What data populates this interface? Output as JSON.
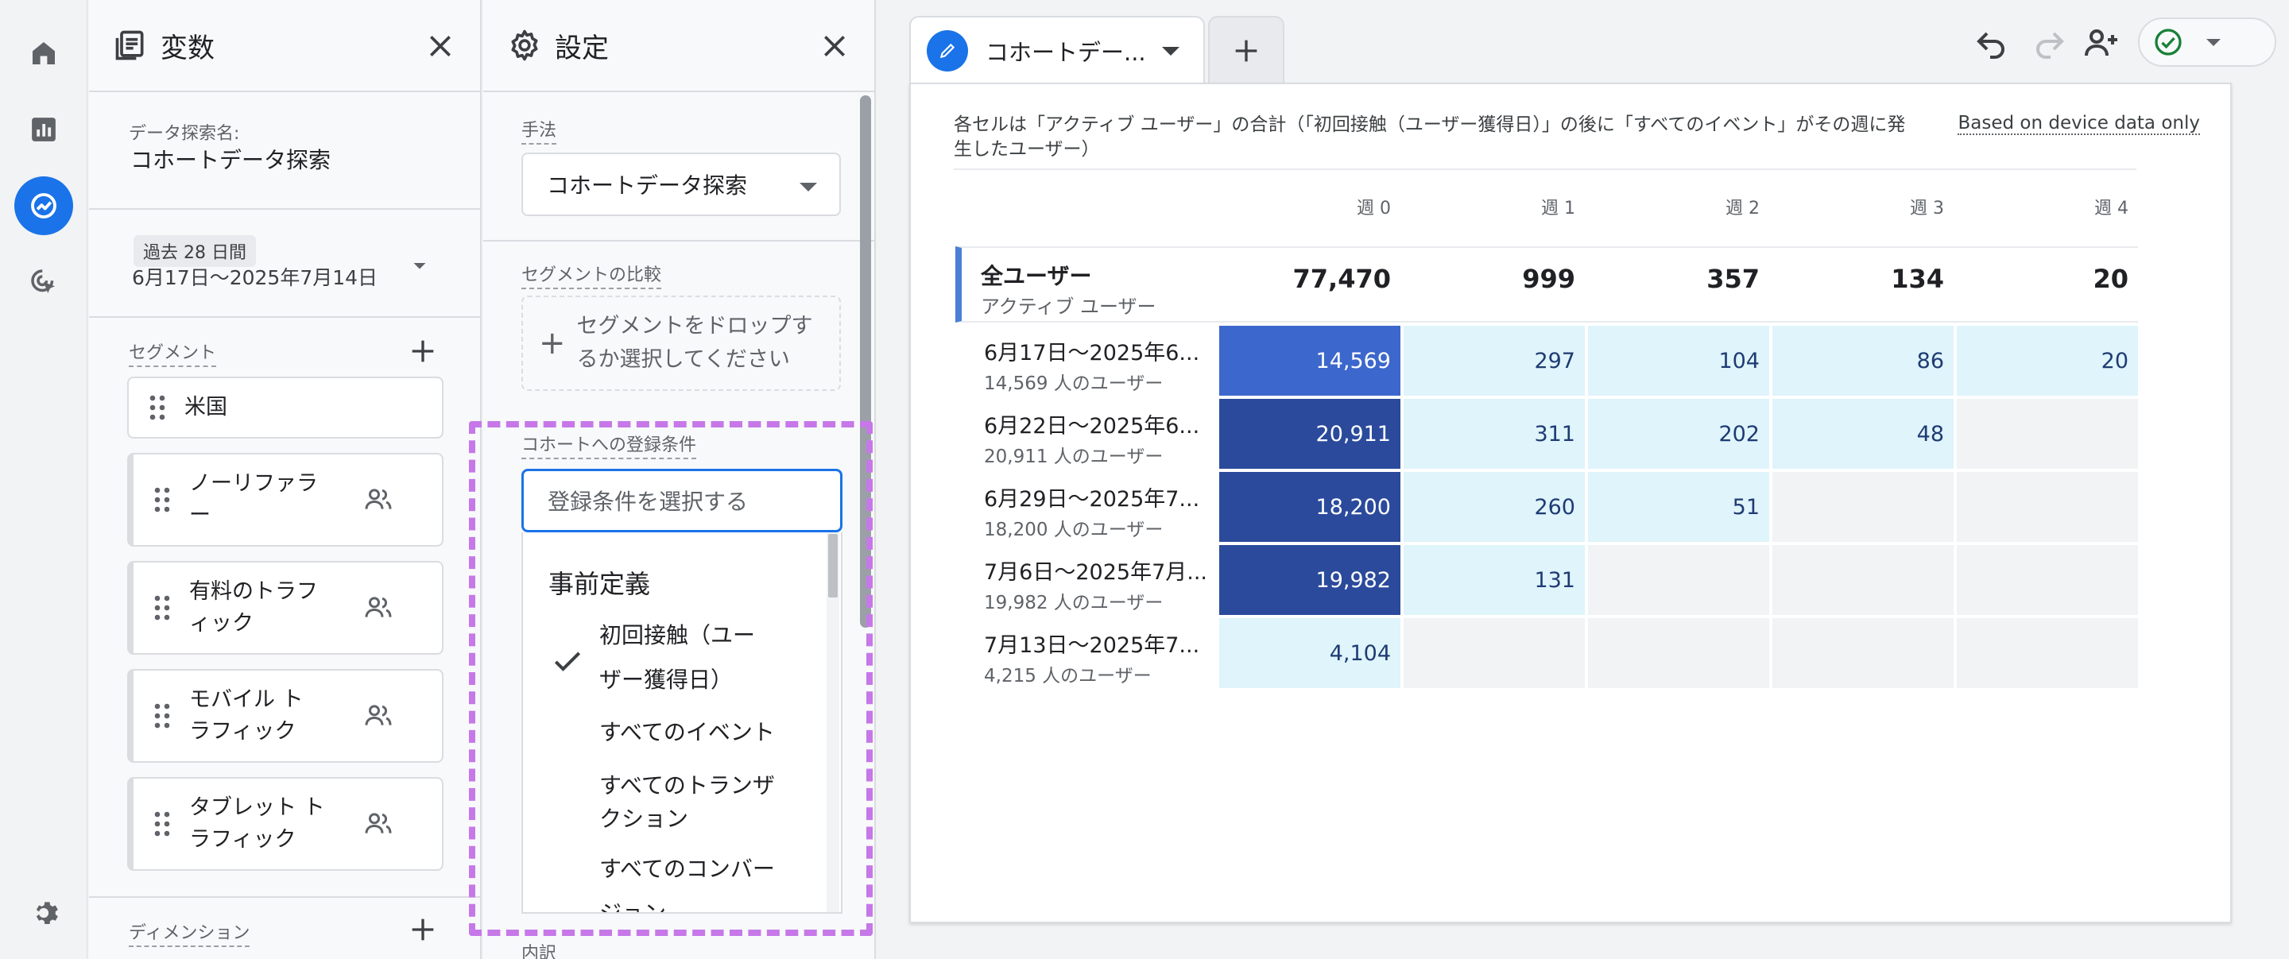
{
  "vars_panel": {
    "title": "変数",
    "explore_name_label": "データ探索名:",
    "explore_name": "コホートデータ探索",
    "date_chip": "過去 28 日間",
    "date_range": "6月17日～2025年7月14日",
    "segments_label": "セグメント",
    "segments": [
      {
        "lines": [
          "米国"
        ],
        "has_icon": false
      },
      {
        "lines": [
          "ノーリファラ",
          "ー"
        ],
        "has_icon": true
      },
      {
        "lines": [
          "有料のトラフ",
          "ィック"
        ],
        "has_icon": true
      },
      {
        "lines": [
          "モバイル ト",
          "ラフィック"
        ],
        "has_icon": true
      },
      {
        "lines": [
          "タブレット ト",
          "ラフィック"
        ],
        "has_icon": true
      }
    ],
    "dimensions_label": "ディメンション"
  },
  "settings_panel": {
    "title": "設定",
    "method_label": "手法",
    "method_value": "コホートデータ探索",
    "segment_compare_label": "セグメントの比較",
    "drop_zone_line1": "セグメントをドロップす",
    "drop_zone_line2": "るか選択してください",
    "cohort_condition_label": "コホートへの登録条件",
    "cohort_condition_placeholder": "登録条件を選択する",
    "dropdown_group": "事前定義",
    "dropdown_options": [
      {
        "line1": "初回接触（ユー",
        "line2": "ザー獲得日）",
        "selected": true
      },
      {
        "line1": "すべてのイベント",
        "line2": "",
        "selected": false
      },
      {
        "line1": "すべてのトランザ",
        "line2": "クション",
        "selected": false
      },
      {
        "line1": "すべてのコンバー",
        "line2": "ジョン",
        "selected": false
      }
    ],
    "breakdown_label": "内訳"
  },
  "tab": {
    "label": "コホートデー..."
  },
  "report": {
    "description": "各セルは「アクティブ ユーザー」の合計（「初回接触（ユーザー獲得日）」の後に「すべてのイベント」がその週に発生したユーザー）",
    "device_link": "Based on device data only",
    "week_headers": [
      "週 0",
      "週 1",
      "週 2",
      "週 3",
      "週 4"
    ],
    "total": {
      "name": "全ユーザー",
      "sub": "アクティブ ユーザー",
      "values": [
        "77,470",
        "999",
        "357",
        "134",
        "20"
      ]
    },
    "rows": [
      {
        "name": "6月17日～2025年6...",
        "sub": "14,569 人のユーザー",
        "values": [
          "14,569",
          "297",
          "104",
          "86",
          "20"
        ]
      },
      {
        "name": "6月22日～2025年6...",
        "sub": "20,911 人のユーザー",
        "values": [
          "20,911",
          "311",
          "202",
          "48",
          ""
        ]
      },
      {
        "name": "6月29日～2025年7...",
        "sub": "18,200 人のユーザー",
        "values": [
          "18,200",
          "260",
          "51",
          "",
          ""
        ]
      },
      {
        "name": "7月6日～2025年7月...",
        "sub": "19,982 人のユーザー",
        "values": [
          "19,982",
          "131",
          "",
          "",
          ""
        ]
      },
      {
        "name": "7月13日～2025年7...",
        "sub": "4,215 人のユーザー",
        "values": [
          "4,104",
          "",
          "",
          "",
          ""
        ]
      }
    ]
  },
  "colors": {
    "accent": "#1a73e8",
    "highlight": "#c678e8",
    "cell_dark": "#2b4a9c",
    "cell_mid": "#3c67cc",
    "cell_light": "#dff4fb",
    "cell_empty": "#f1f3f4"
  },
  "icons": [
    "home-icon",
    "reports-icon",
    "explore-icon",
    "advertising-icon",
    "admin-gear-icon",
    "variables-icon",
    "settings-gear-icon",
    "close-icon",
    "add-icon",
    "drag-grip-icon",
    "people-icon",
    "check-icon",
    "pencil-icon",
    "undo-icon",
    "redo-icon",
    "share-user-icon",
    "check-circle-icon"
  ]
}
